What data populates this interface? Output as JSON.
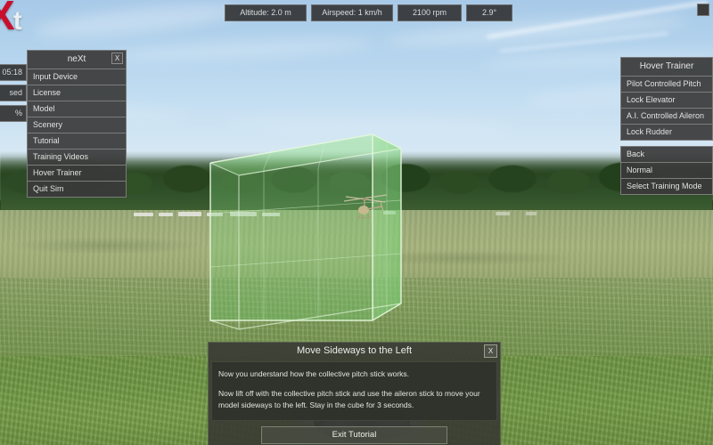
{
  "logo": {
    "x": "X",
    "t": "t"
  },
  "hud": {
    "altitude": "Altitude: 2.0 m",
    "airspeed": "Airspeed: 1 km/h",
    "rpm": "2100 rpm",
    "angle": "2.9°"
  },
  "stats": {
    "time": "05:18",
    "used": "sed",
    "percent": "%"
  },
  "menu": {
    "title": "neXt",
    "close_label": "X",
    "items": [
      {
        "label": "Input Device"
      },
      {
        "label": "License"
      },
      {
        "label": "Model"
      },
      {
        "label": "Scenery"
      },
      {
        "label": "Tutorial"
      },
      {
        "label": "Training Videos"
      },
      {
        "label": "Hover Trainer"
      },
      {
        "label": "Quit Sim"
      }
    ]
  },
  "trainer": {
    "title": "Hover Trainer",
    "items": [
      {
        "label": "Pilot Controlled Pitch"
      },
      {
        "label": "Lock Elevator"
      },
      {
        "label": "A.I. Controlled Aileron"
      },
      {
        "label": "Lock Rudder"
      }
    ],
    "items2": [
      {
        "label": "Back"
      },
      {
        "label": "Normal"
      },
      {
        "label": "Select Training Mode"
      }
    ]
  },
  "dialog": {
    "title": "Move Sideways to the Left",
    "close_label": "X",
    "paragraph1": "Now you understand how the collective pitch stick works.",
    "paragraph2": "Now lift off with the collective pitch stick and use the aileron stick to move your model sideways to the left. Stay in the cube for 3 seconds.",
    "exit_label": "Exit Tutorial"
  },
  "colors": {
    "cube_edge": "#d8f3cf",
    "cube_fill": "#7fd37a",
    "panel_bg": "#3a3a3a",
    "panel_border": "#7c7c7c",
    "logo_red": "#c8102e"
  }
}
